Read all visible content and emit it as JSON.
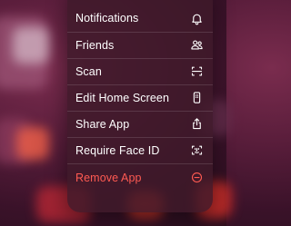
{
  "menu": {
    "items": [
      {
        "label": "Notifications",
        "icon": "bell-icon"
      },
      {
        "label": "Friends",
        "icon": "people-icon"
      },
      {
        "label": "Scan",
        "icon": "scan-icon"
      },
      {
        "label": "Edit Home Screen",
        "icon": "phone-icon"
      },
      {
        "label": "Share App",
        "icon": "share-icon"
      },
      {
        "label": "Require Face ID",
        "icon": "face-id-icon"
      },
      {
        "label": "Remove App",
        "icon": "minus-circle-icon",
        "destructive": true
      }
    ]
  },
  "colors": {
    "menu_background": "#3e1a2a",
    "text": "#ffffff",
    "destructive": "#ff5a52"
  }
}
